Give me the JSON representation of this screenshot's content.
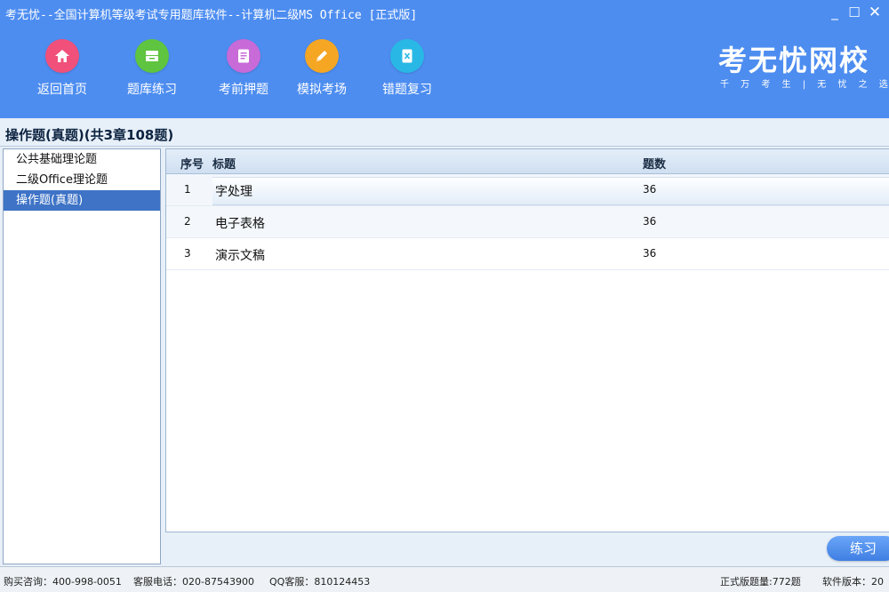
{
  "window": {
    "title": "考无忧--全国计算机等级考试专用题库软件--计算机二级MS Office [正式版]",
    "minimize": "_",
    "maximize": "☐",
    "close": "✕"
  },
  "nav": {
    "items": [
      {
        "label": "返回首页",
        "icon": "home-icon",
        "color": "#f0507a"
      },
      {
        "label": "题库练习",
        "icon": "question-bank-icon",
        "color": "#5fc43f"
      },
      {
        "label": "考前押题",
        "icon": "document-icon",
        "color": "#c86ad8"
      },
      {
        "label": "模拟考场",
        "icon": "pencil-icon",
        "color": "#f5a623"
      },
      {
        "label": "错题复习",
        "icon": "error-review-icon",
        "color": "#29b8e6"
      }
    ]
  },
  "logo": {
    "main": "考无忧网校",
    "sub": "千 万 考 生 | 无 忧 之 选"
  },
  "section": {
    "title": "操作题(真题)(共3章108题)"
  },
  "sidebar": {
    "items": [
      {
        "label": "公共基础理论题",
        "active": false
      },
      {
        "label": "二级Office理论题",
        "active": false
      },
      {
        "label": "操作题(真题)",
        "active": true
      }
    ]
  },
  "table": {
    "headers": {
      "no": "序号",
      "title": "标题",
      "count": "题数"
    },
    "rows": [
      {
        "no": "1",
        "title": "字处理",
        "count": "36"
      },
      {
        "no": "2",
        "title": "电子表格",
        "count": "36"
      },
      {
        "no": "3",
        "title": "演示文稿",
        "count": "36"
      }
    ]
  },
  "actions": {
    "practice": "练习"
  },
  "footer": {
    "purchase": "购买咨询：400-998-0051",
    "service": "客服电话：020-87543900",
    "qq": "QQ客服：810124453",
    "count": "正式版题量:772题",
    "version": "软件版本：20"
  }
}
